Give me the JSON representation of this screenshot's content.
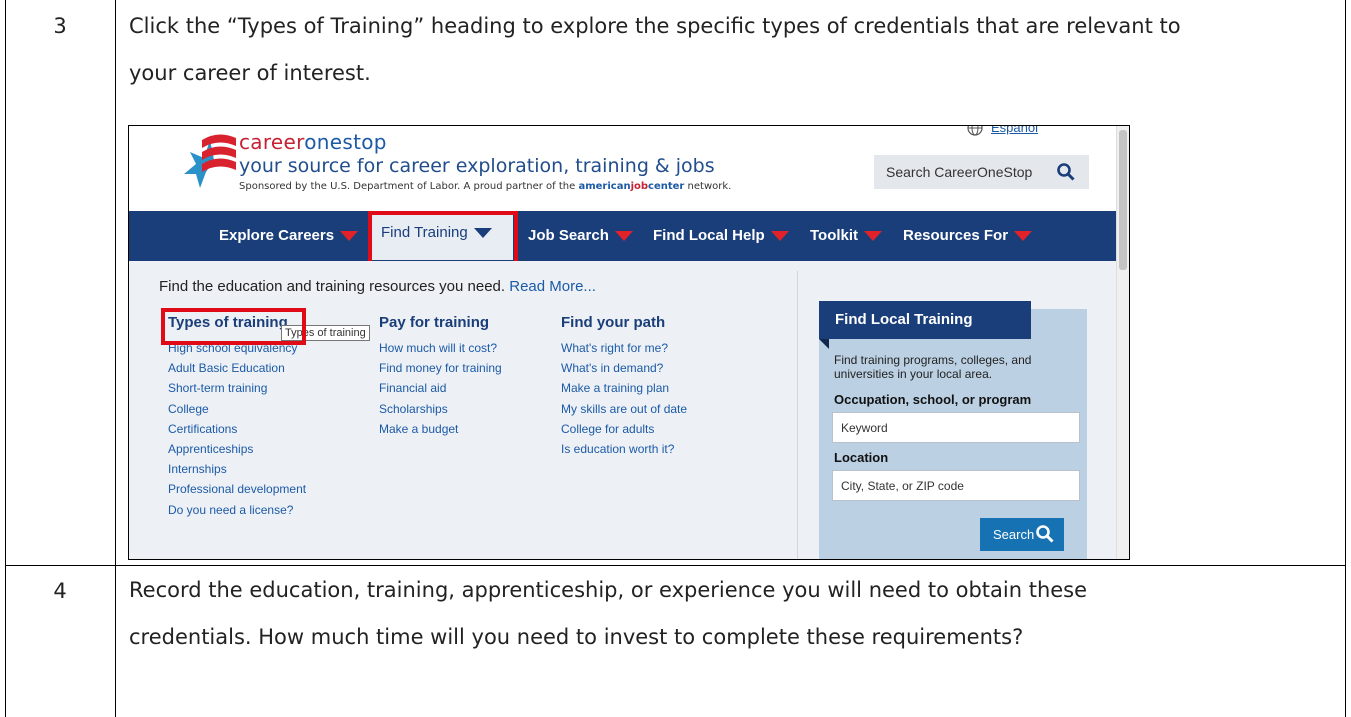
{
  "rows": [
    {
      "step": "3",
      "instruction_line1": "Click the “Types of Training” heading to explore the specific types of credentials that are relevant to",
      "instruction_line2": "your career of interest."
    },
    {
      "step": "4",
      "instruction_line1": "Record the education, training, apprenticeship, or experience you will need to obtain these",
      "instruction_line2": "credentials. How much time will you need to invest to complete these requirements?"
    }
  ],
  "site": {
    "brand_part1": "career",
    "brand_part2": "onestop",
    "tagline": "your source for career exploration, training & jobs",
    "sponsor_prefix": "Sponsored by the U.S. Department of Labor. A proud partner of the ",
    "ajc_part1": "american",
    "ajc_part2": "job",
    "ajc_part3": "center",
    "sponsor_suffix": " network.",
    "language_link": "Español",
    "search_label": "Search CareerOneStop"
  },
  "nav": {
    "items": [
      "Explore Careers",
      "Find Training",
      "Job Search",
      "Find Local Help",
      "Toolkit",
      "Resources For"
    ]
  },
  "menu": {
    "intro": "Find the education and training resources you need.",
    "read_more": "Read More...",
    "columns": [
      {
        "title": "Types of training",
        "links": [
          "High school equivalency",
          "Adult Basic Education",
          "Short-term training",
          "College",
          "Certifications",
          "Apprenticeships",
          "Internships",
          "Professional development",
          "Do you need a license?"
        ]
      },
      {
        "title": "Pay for training",
        "links": [
          "How much will it cost?",
          "Find money for training",
          "Financial aid",
          "Scholarships",
          "Make a budget"
        ]
      },
      {
        "title": "Find your path",
        "links": [
          "What's right for me?",
          "What's in demand?",
          "Make a training plan",
          "My skills are out of date",
          "College for adults",
          "Is education worth it?"
        ]
      }
    ],
    "tooltip": "Types of training"
  },
  "local_training": {
    "title": "Find Local Training",
    "description": "Find training programs, colleges, and universities in your local area.",
    "occupation_label": "Occupation, school, or program",
    "keyword_placeholder": "Keyword",
    "location_label": "Location",
    "location_placeholder": "City, State, or ZIP code",
    "search_button": "Search"
  },
  "colors": {
    "nav_blue": "#1a3e7a",
    "brand_red": "#c62233",
    "highlight_red": "#e10b17",
    "link_blue": "#1c5aa6"
  }
}
